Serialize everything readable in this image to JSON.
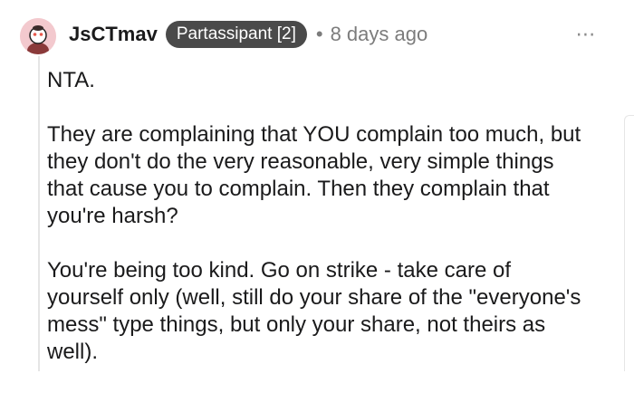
{
  "comment": {
    "username": "JsCTmav",
    "flair": "Partassipant [2]",
    "separator": "•",
    "timestamp": "8 days ago",
    "more_icon": "⋯",
    "paragraphs": [
      "NTA.",
      "They are complaining that YOU complain too much, but they don't do the very reasonable, very simple things that cause you to complain. Then they complain that you're harsh?",
      "You're being too kind. Go on strike - take care of yourself only (well, still do your share of the \"everyone's mess\" type things, but only your share, not theirs as well)."
    ]
  },
  "colors": {
    "flair_bg": "#4a4a4a",
    "avatar_bg": "#f3c9ce",
    "meta_text": "#7c7c7c"
  }
}
